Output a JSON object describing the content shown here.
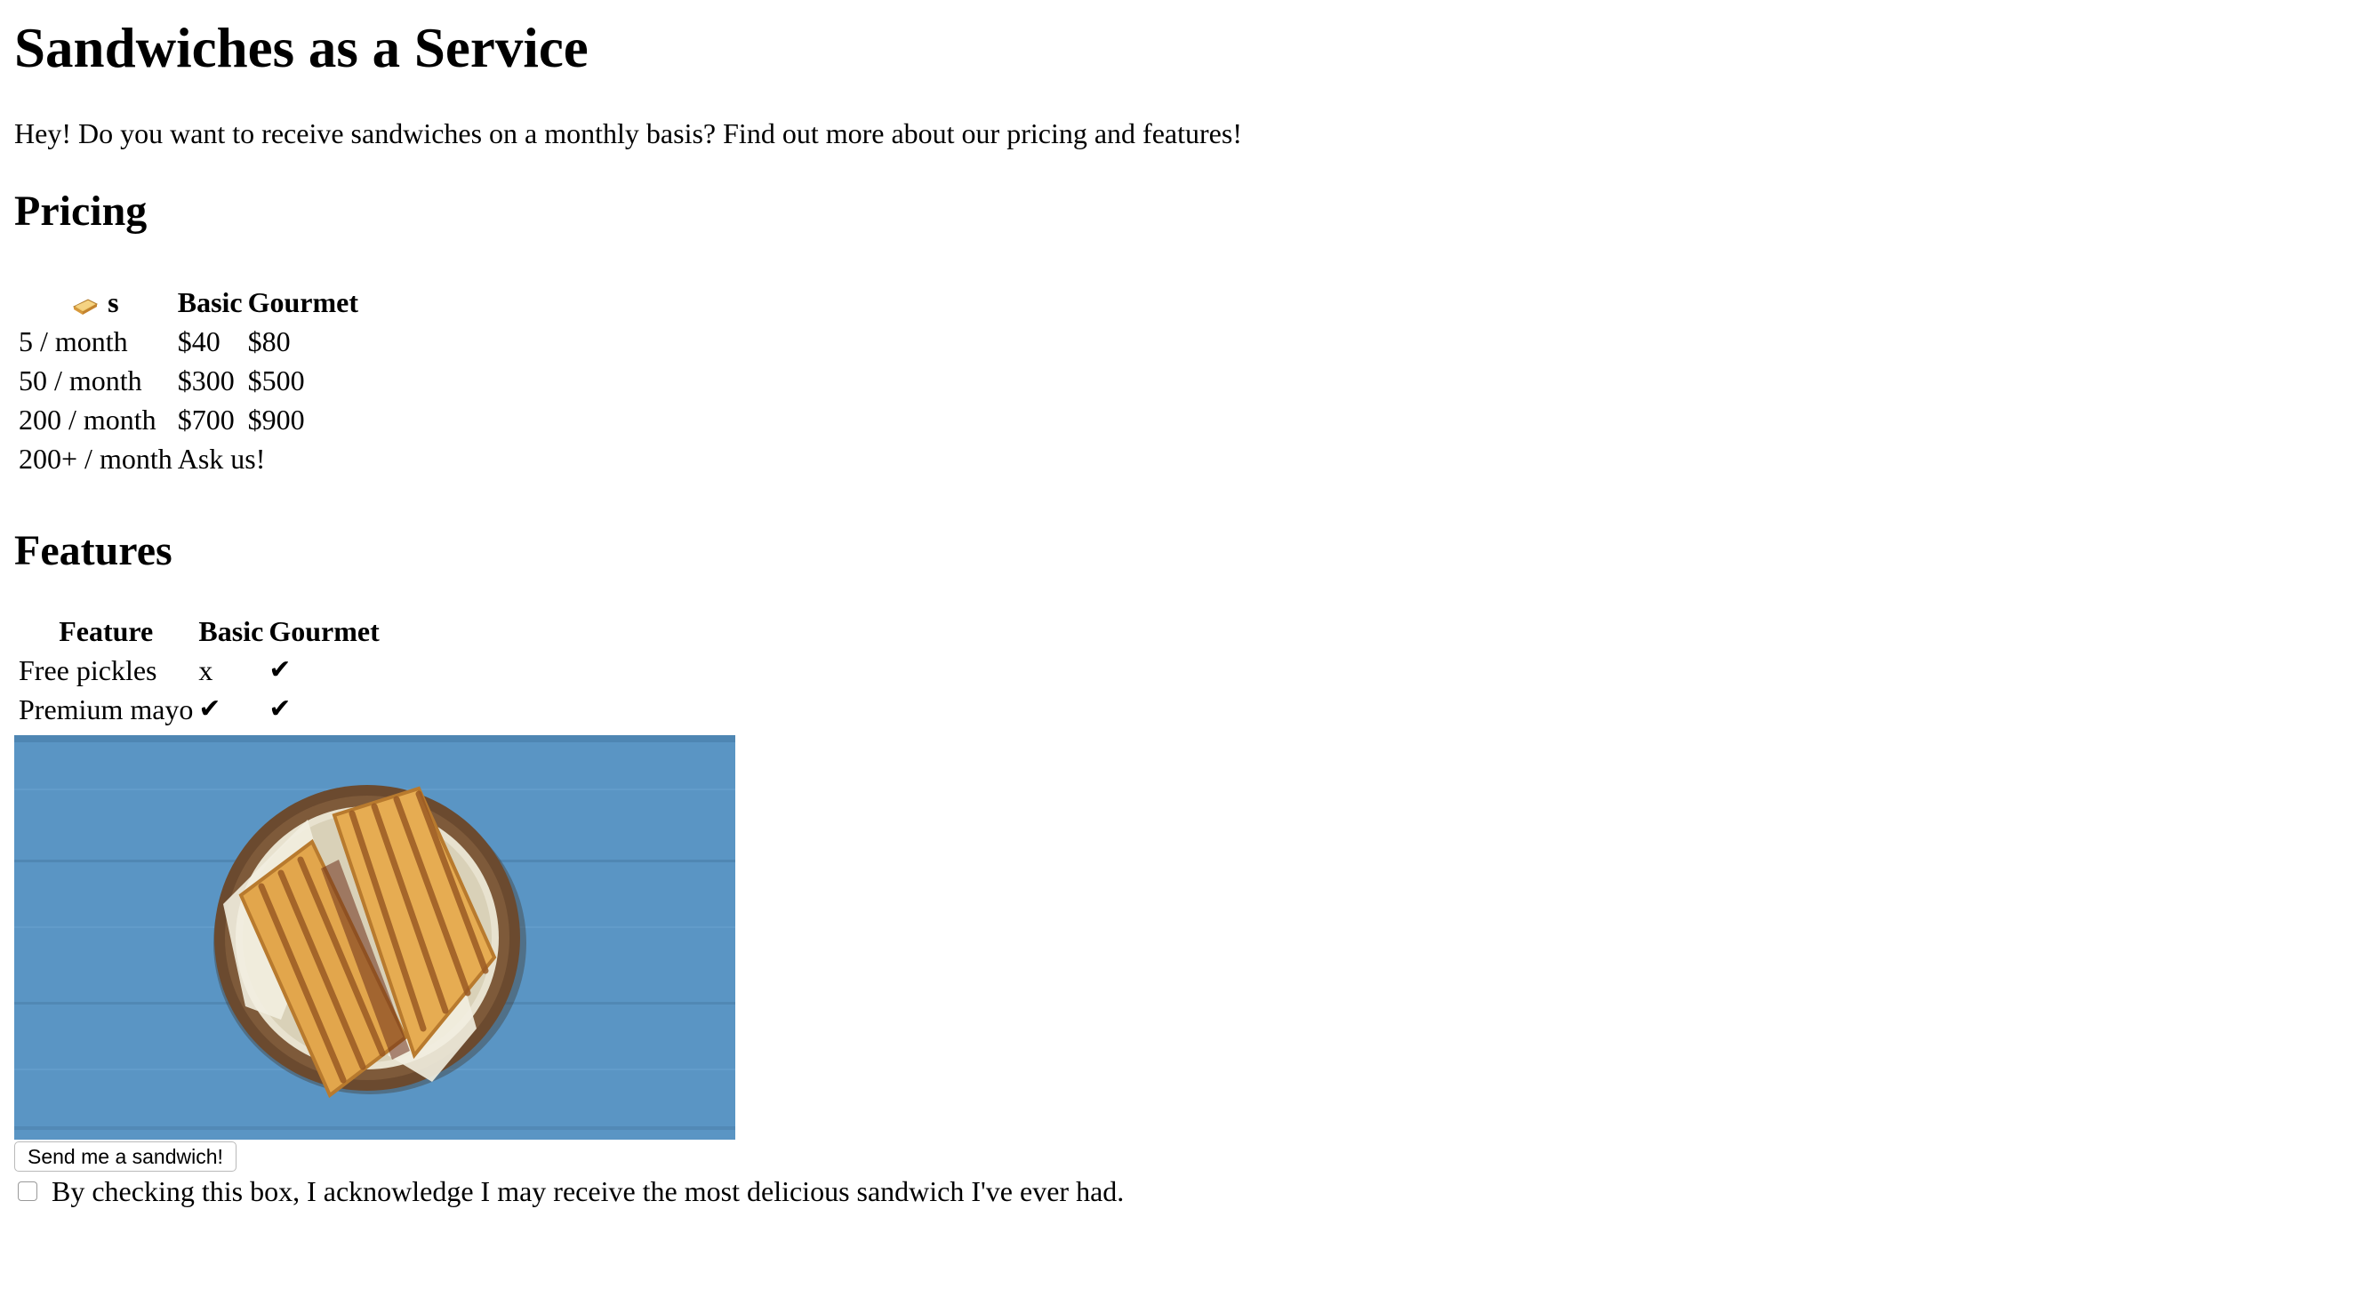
{
  "header": {
    "title": "Sandwiches as a Service",
    "intro": "Hey! Do you want to receive sandwiches on a monthly basis? Find out more about our pricing and features!"
  },
  "pricing": {
    "heading": "Pricing",
    "header_icon": "sandwich-icon",
    "header_suffix": "s",
    "columns": [
      "Basic",
      "Gourmet"
    ],
    "rows": [
      {
        "qty": "5 / month",
        "basic": "$40",
        "gourmet": "$80"
      },
      {
        "qty": "50 / month",
        "basic": "$300",
        "gourmet": "$500"
      },
      {
        "qty": "200 / month",
        "basic": "$700",
        "gourmet": "$900"
      },
      {
        "qty": "200+ / month",
        "note": "Ask us!"
      }
    ]
  },
  "features": {
    "heading": "Features",
    "columns": [
      "Feature",
      "Basic",
      "Gourmet"
    ],
    "rows": [
      {
        "name": "Free pickles",
        "basic": "x",
        "gourmet": "✔"
      },
      {
        "name": "Premium mayo",
        "basic": "✔",
        "gourmet": "✔"
      }
    ]
  },
  "image": {
    "subject": "grilled-sandwich-photo",
    "colors": {
      "table_blue": "#5a95c4",
      "bowl_brown": "#6b4a2f",
      "bread": "#e2a64c",
      "grill_marks": "#9a5a24"
    }
  },
  "actions": {
    "send_label": "Send me a sandwich!",
    "ack_text": "By checking this box, I acknowledge I may receive the most delicious sandwich I've ever had.",
    "ack_checked": false
  }
}
